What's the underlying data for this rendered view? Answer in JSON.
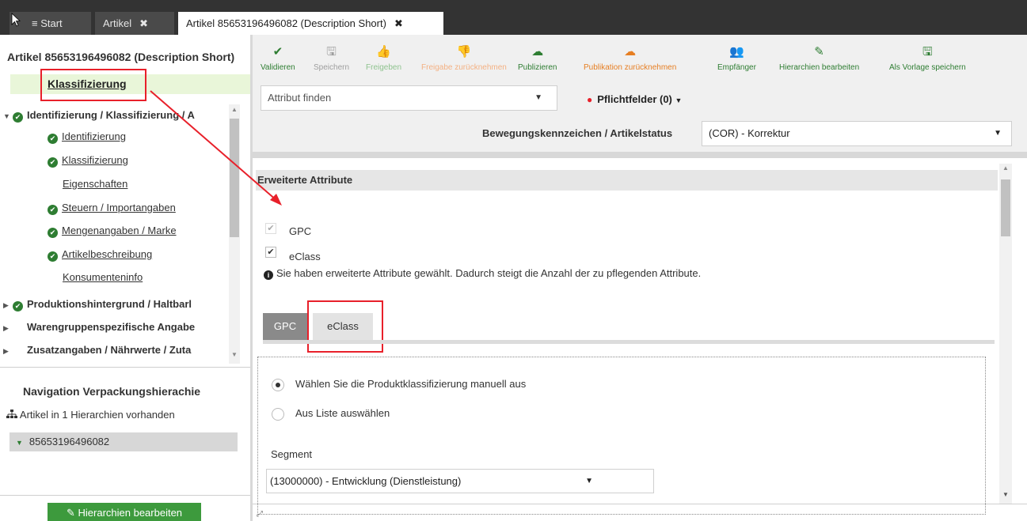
{
  "tabs": {
    "start": "≡ Start",
    "artikel": "Artikel",
    "active": "Artikel 85653196496082 (Description Short)",
    "close": "✖"
  },
  "left": {
    "title": "Artikel 85653196496082 (Description Short)",
    "selected": "Klassifizierung",
    "tree": [
      {
        "label": "Identifizierung / Klassifizierung / A",
        "level": 0,
        "check": true,
        "expanded": true
      },
      {
        "label": "Identifizierung",
        "level": 1,
        "check": true
      },
      {
        "label": "Klassifizierung",
        "level": 1,
        "check": true
      },
      {
        "label": "Eigenschaften",
        "level": 1,
        "check": false
      },
      {
        "label": "Steuern / Importangaben",
        "level": 1,
        "check": true
      },
      {
        "label": "Mengenangaben / Marke",
        "level": 1,
        "check": true
      },
      {
        "label": "Artikelbeschreibung",
        "level": 1,
        "check": true
      },
      {
        "label": "Konsumenteninfo",
        "level": 1,
        "check": false
      },
      {
        "label": "Produktionshintergrund / Haltbarl",
        "level": 0,
        "check": true,
        "expanded": false
      },
      {
        "label": "Warengruppenspezifische Angabe",
        "level": 0,
        "check": false,
        "expanded": false
      },
      {
        "label": "Zusatzangaben / Nährwerte / Zuta",
        "level": 0,
        "check": false,
        "expanded": false
      }
    ],
    "nav_title": "Navigation Verpackungshierachie",
    "hier_info": "Artikel in 1 Hierarchien vorhanden",
    "hier_item": "85653196496082",
    "button": "Hierarchien bearbeiten"
  },
  "toolbar": {
    "items": [
      {
        "label": "Validieren",
        "icon": "check-icon",
        "color": "#2e7d32"
      },
      {
        "label": "Speichern",
        "icon": "save-icon",
        "color": "#9e9e9e"
      },
      {
        "label": "Freigeben",
        "icon": "thumbs-up-icon",
        "color": "#8fc38f"
      },
      {
        "label": "Freigabe zurücknehmen",
        "icon": "thumbs-down-icon",
        "color": "#f4b183"
      },
      {
        "label": "Publizieren",
        "icon": "cloud-upload-icon",
        "color": "#2e7d32"
      },
      {
        "label": "Publikation zurücknehmen",
        "icon": "cloud-download-icon",
        "color": "#e67e22"
      },
      {
        "label": "Empfänger",
        "icon": "users-icon",
        "color": "#2e7d32"
      },
      {
        "label": "Hierarchien bearbeiten",
        "icon": "pencil-icon",
        "color": "#2e7d32"
      },
      {
        "label": "Als Vorlage speichern",
        "icon": "save-icon",
        "color": "#2e7d32"
      }
    ],
    "attr_find_placeholder": "Attribut finden",
    "pflicht": "Pflichtfelder (0)",
    "bew_label": "Bewegungskennzeichen / Artikelstatus",
    "bew_value": "(COR) - Korrektur"
  },
  "content": {
    "section": "Erweiterte Attribute",
    "checkboxes": [
      {
        "label": "GPC",
        "checked": true,
        "disabled": true
      },
      {
        "label": "eClass",
        "checked": true,
        "disabled": false
      }
    ],
    "info": "Sie haben erweiterte Attribute gewählt. Dadurch steigt die Anzahl der zu pflegenden Attribute.",
    "tabs": [
      "GPC",
      "eClass"
    ],
    "radios": [
      {
        "label": "Wählen Sie die Produktklassifizierung manuell aus",
        "selected": true
      },
      {
        "label": "Aus Liste auswählen",
        "selected": false
      }
    ],
    "segment_label": "Segment",
    "segment_value": "(13000000) - Entwicklung (Dienstleistung)"
  }
}
